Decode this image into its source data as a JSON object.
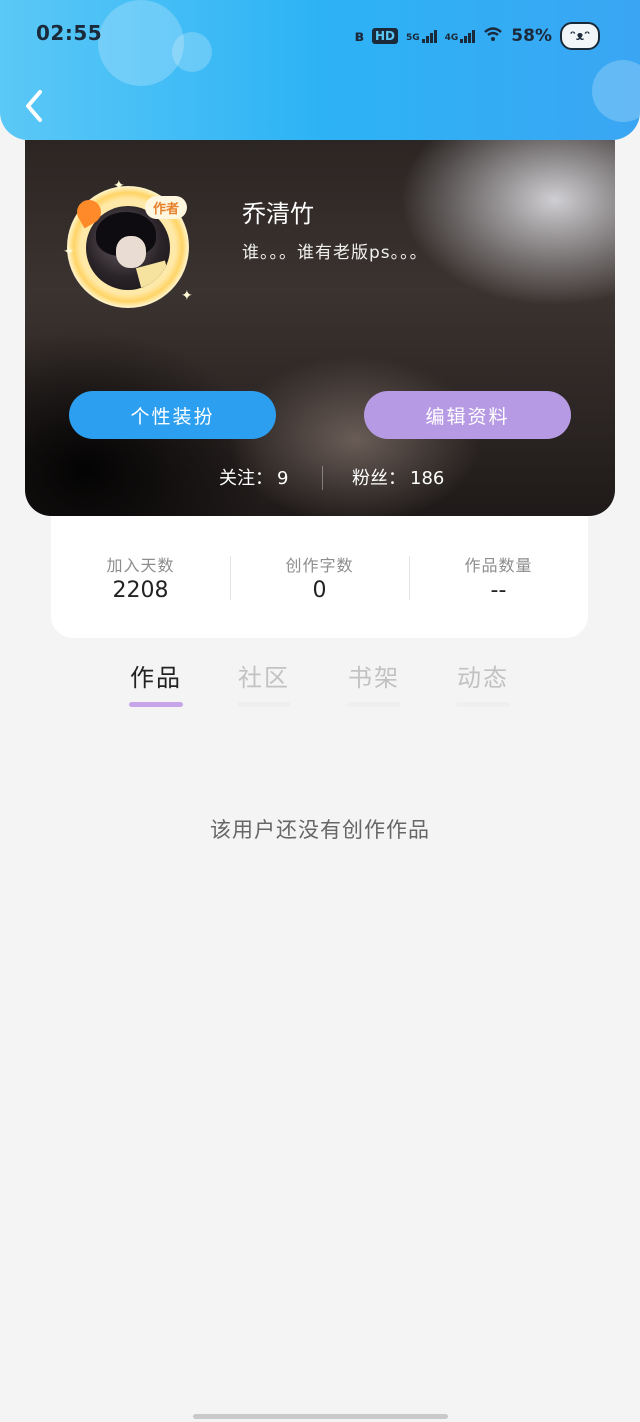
{
  "status_bar": {
    "time": "02:55",
    "hd_label": "HD",
    "net_5g": "5G",
    "net_4g": "4G",
    "battery": "58%"
  },
  "profile": {
    "author_badge": "作者",
    "username": "乔清竹",
    "bio": "谁。。。谁有老版ps。。。",
    "buttons": {
      "dress_up": "个性装扮",
      "edit_profile": "编辑资料"
    },
    "follow_label": "关注：",
    "follow_count": "9",
    "fans_label": "粉丝：",
    "fans_count": "186"
  },
  "stats": [
    {
      "label": "加入天数",
      "value": "2208"
    },
    {
      "label": "创作字数",
      "value": "0"
    },
    {
      "label": "作品数量",
      "value": "--"
    }
  ],
  "tabs": [
    {
      "label": "作品",
      "active": true
    },
    {
      "label": "社区",
      "active": false
    },
    {
      "label": "书架",
      "active": false
    },
    {
      "label": "动态",
      "active": false
    }
  ],
  "empty_state": "该用户还没有创作作品",
  "colors": {
    "header_blue": "#2db3f5",
    "dress_button": "#2c9ff0",
    "edit_button": "#b79ae4",
    "active_tab_underline": "#c6a6e8"
  }
}
